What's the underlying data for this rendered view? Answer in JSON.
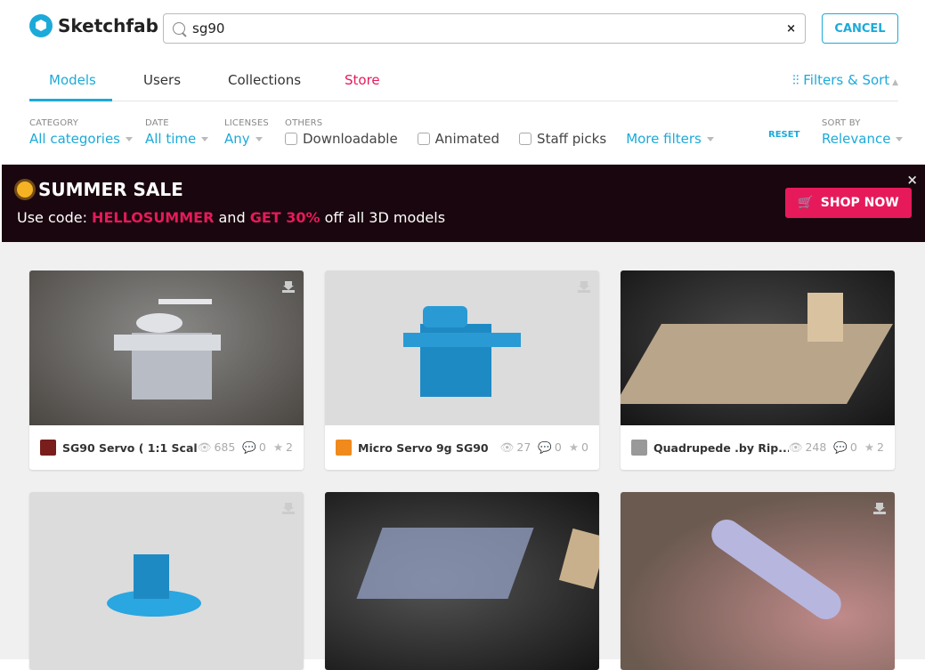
{
  "header": {
    "logo": "Sketchfab",
    "search_value": "sg90",
    "clear": "×",
    "cancel": "CANCEL"
  },
  "tabs": [
    {
      "label": "Models",
      "active": true
    },
    {
      "label": "Users"
    },
    {
      "label": "Collections"
    },
    {
      "label": "Store"
    }
  ],
  "filters_sort": "Filters & Sort",
  "filters": {
    "category": {
      "label": "CATEGORY",
      "value": "All categories"
    },
    "date": {
      "label": "DATE",
      "value": "All time"
    },
    "licenses": {
      "label": "LICENSES",
      "value": "Any"
    },
    "others": {
      "label": "OTHERS",
      "checkboxes": [
        "Downloadable",
        "Animated",
        "Staff picks"
      ],
      "more": "More filters"
    },
    "reset": "RESET",
    "sort": {
      "label": "SORT BY",
      "value": "Relevance"
    }
  },
  "banner": {
    "title": "SUMMER SALE",
    "pre": "Use code: ",
    "code": "HELLOSUMMER",
    "mid": " and ",
    "offer": "GET 30%",
    "post": " off all 3D models",
    "button": "SHOP NOW",
    "close": "×"
  },
  "colors": {
    "accent": "#1caad9",
    "brand_pink": "#e61a5b",
    "banner_bg": "#1a060e"
  },
  "cards": [
    {
      "name": "SG90 Servo ( 1:1 Scal...",
      "views": "685",
      "comments": "0",
      "likes": "2"
    },
    {
      "name": "Micro Servo 9g SG90",
      "views": "27",
      "comments": "0",
      "likes": "0"
    },
    {
      "name": "Quadrupede .by Rip...",
      "views": "248",
      "comments": "0",
      "likes": "2"
    },
    {},
    {},
    {}
  ]
}
